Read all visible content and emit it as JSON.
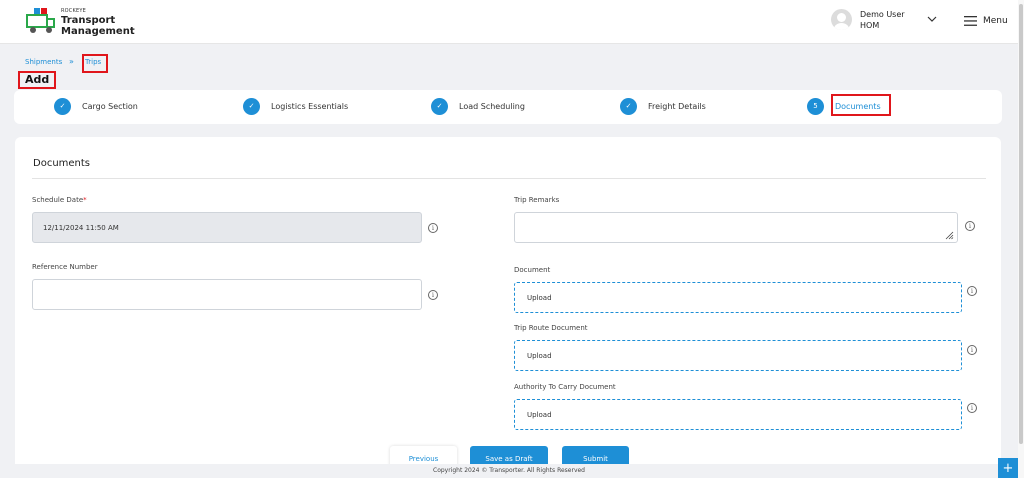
{
  "header": {
    "brand_small": "ROCKEYE",
    "brand_line1": "Transport",
    "brand_line2": "Management",
    "user_name": "Demo User",
    "user_role": "HOM",
    "menu_label": "Menu"
  },
  "breadcrumb": {
    "items": [
      "Shipments",
      "Trips"
    ],
    "separator": "»"
  },
  "page_title": "Add",
  "stepper": {
    "steps": [
      {
        "label": "Cargo Section",
        "marker": "✓"
      },
      {
        "label": "Logistics Essentials",
        "marker": "✓"
      },
      {
        "label": "Load Scheduling",
        "marker": "✓"
      },
      {
        "label": "Freight Details",
        "marker": "✓"
      },
      {
        "label": "Documents",
        "marker": "5"
      }
    ]
  },
  "form": {
    "section_title": "Documents",
    "schedule_date_label": "Schedule Date",
    "schedule_date_required": "*",
    "schedule_date_value": "12/11/2024 11:50 AM",
    "reference_number_label": "Reference Number",
    "reference_number_value": "",
    "trip_remarks_label": "Trip Remarks",
    "trip_remarks_value": "",
    "document_label": "Document",
    "document_upload": "Upload",
    "trip_route_label": "Trip Route Document",
    "trip_route_upload": "Upload",
    "authority_label": "Authority To Carry Document",
    "authority_upload": "Upload",
    "info_glyph": "i"
  },
  "buttons": {
    "previous": "Previous",
    "save_draft": "Save as Draft",
    "submit": "Submit"
  },
  "footer": "Copyright 2024 © Transporter. All Rights Reserved",
  "fab_glyph": "+",
  "colors": {
    "accent": "#1e8fd6",
    "highlight": "#e0161b"
  }
}
